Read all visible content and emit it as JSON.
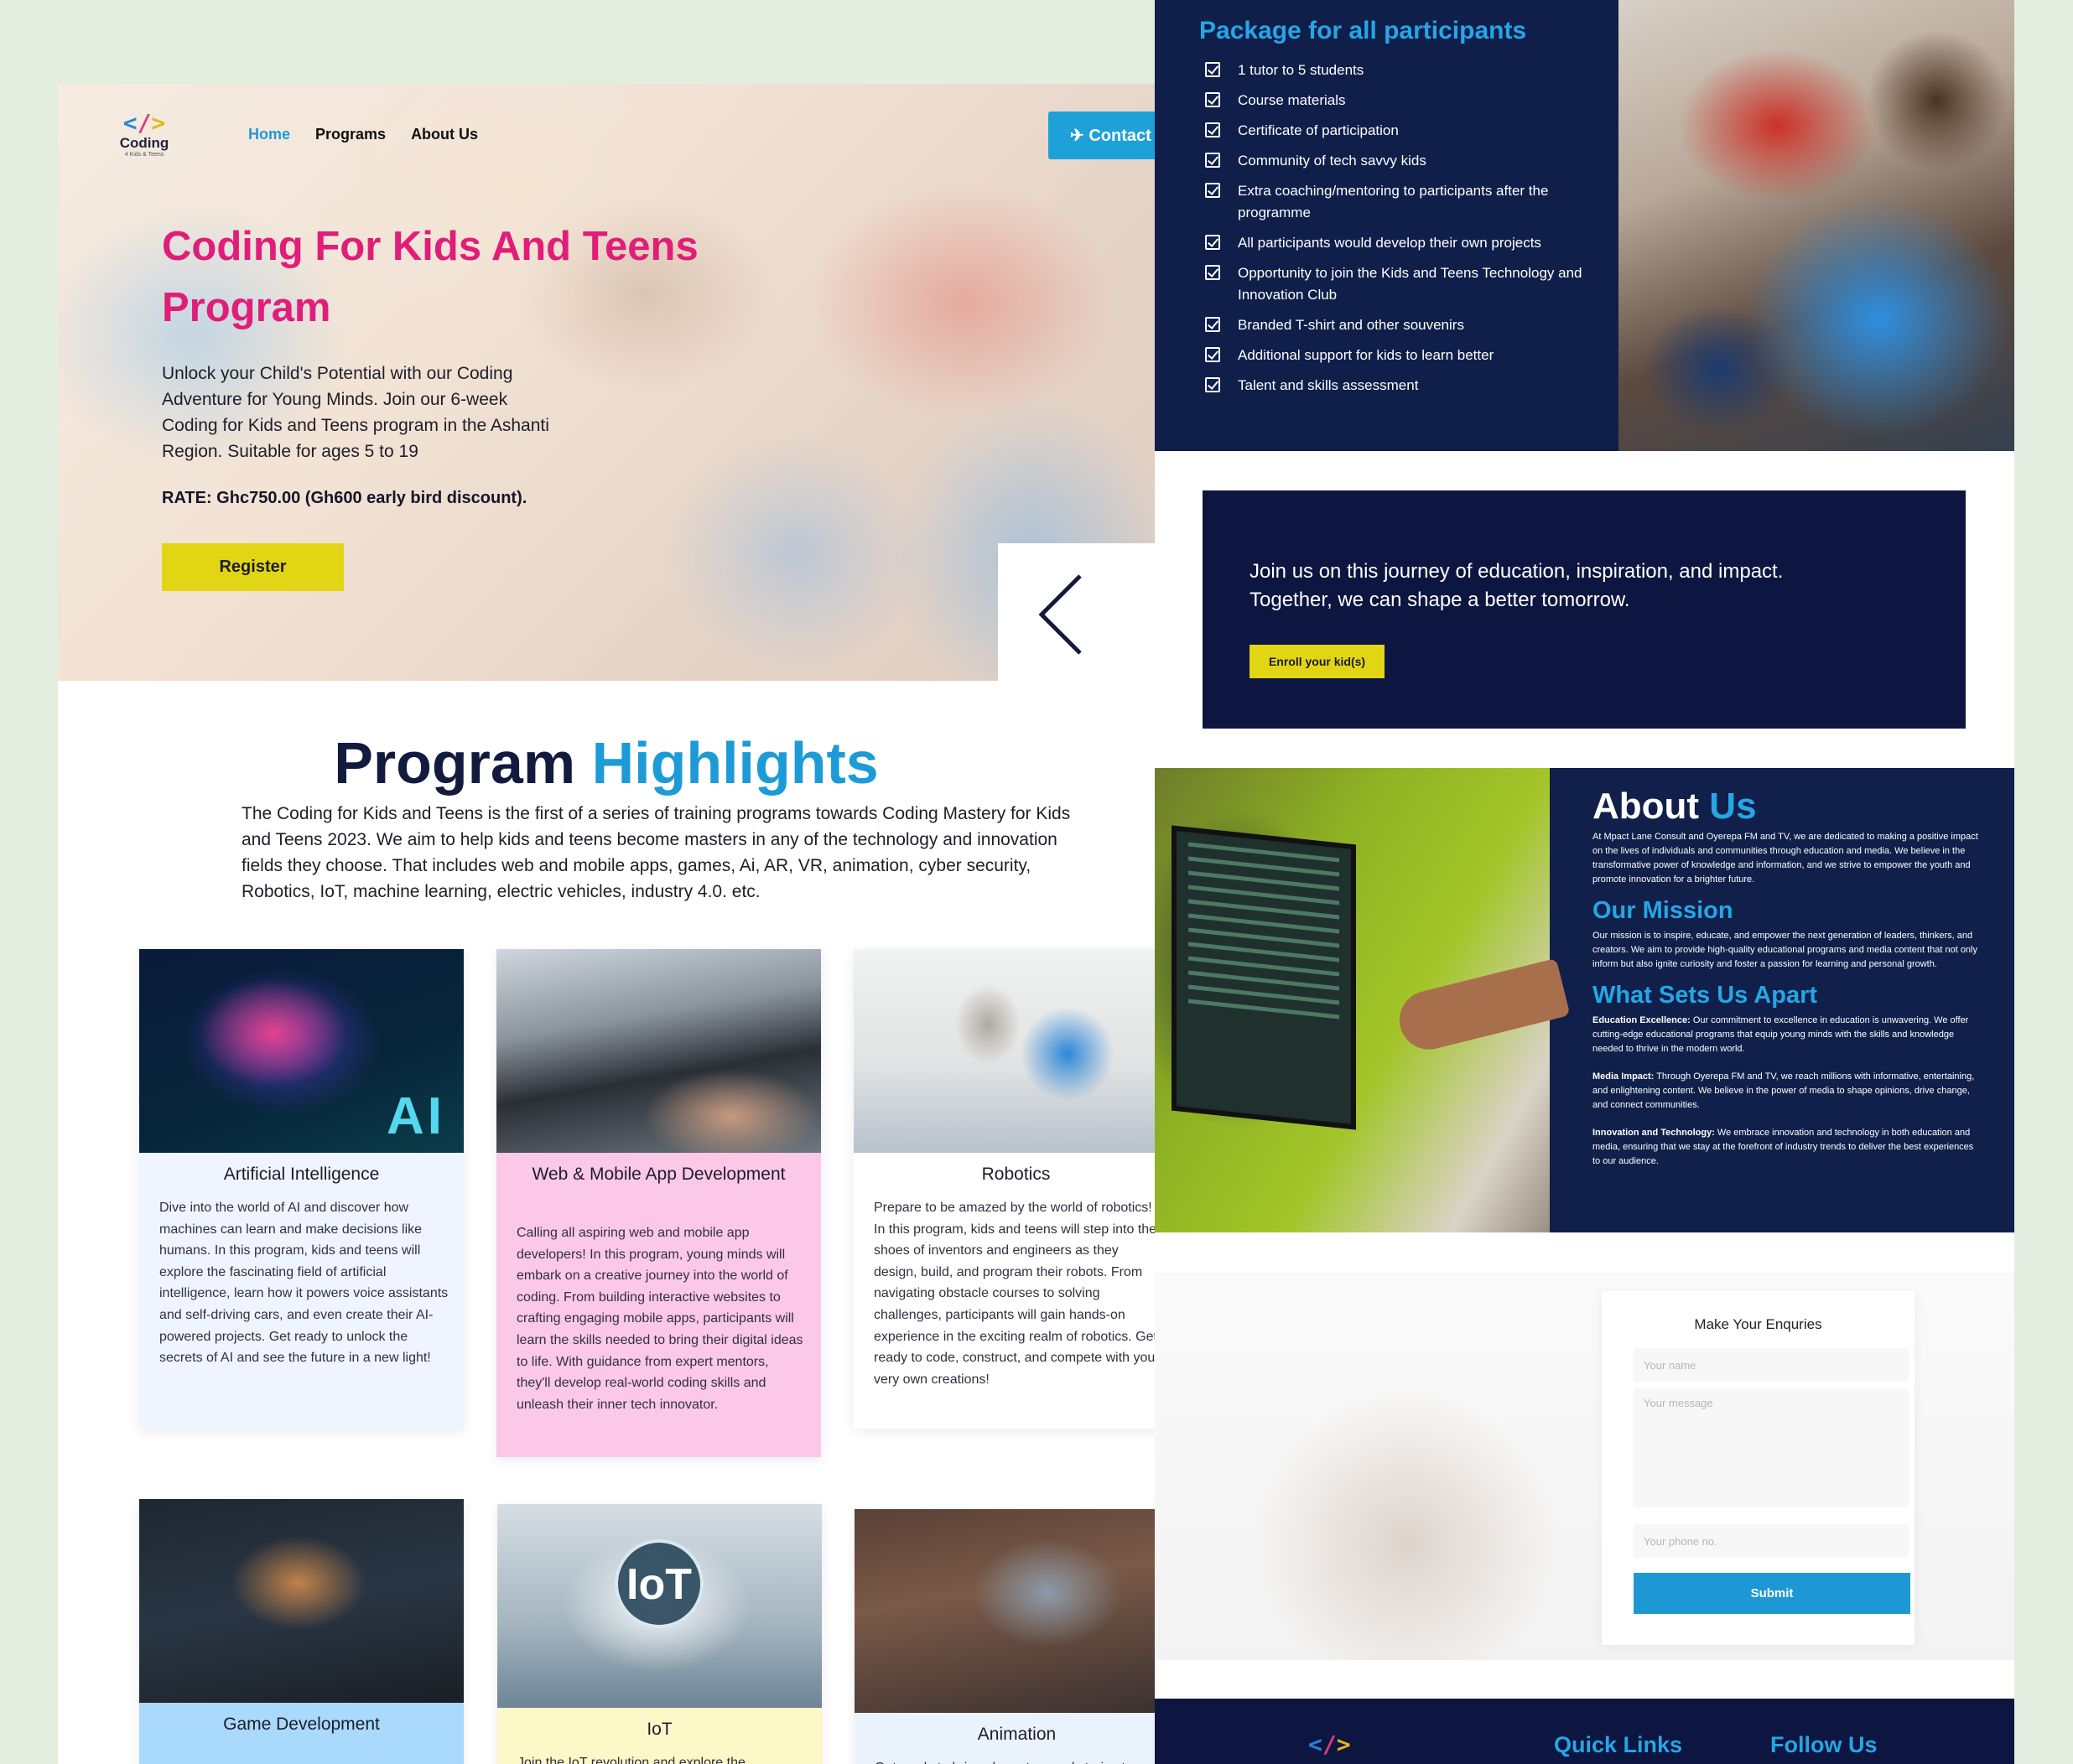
{
  "nav": {
    "logo_word": "Coding",
    "logo_sub": "4 Kids & Teens",
    "items": [
      "Home",
      "Programs",
      "About Us"
    ],
    "contact_label": "Contact"
  },
  "hero": {
    "title": "Coding For Kids And Teens Program",
    "description": "Unlock your Child's Potential with our Coding Adventure for Young Minds.  Join our 6-week Coding for Kids and Teens program in the Ashanti Region.  Suitable for ages 5 to 19",
    "rate": "RATE: Ghc750.00 (Gh600 early bird discount).",
    "register_label": "Register"
  },
  "highlights": {
    "title_main": "Program",
    "title_accent": "Highlights",
    "description": "The Coding for Kids and Teens is the first of a series of training programs towards Coding Mastery for Kids and Teens 2023. We aim to help kids and teens become masters in any of the technology and innovation fields they choose. That includes web and mobile apps, games, Ai, AR, VR, animation, cyber security, Robotics, IoT, machine learning, electric vehicles, industry 4.0. etc.",
    "cards": [
      {
        "title": "Artificial Intelligence",
        "image_text": "AI",
        "bg": "#eef5ff",
        "text": "Dive into the world of AI and discover how machines can learn and make decisions like humans. In this program, kids and teens will explore the fascinating field of artificial intelligence, learn how it powers voice assistants and self-driving cars, and even create their AI-powered projects. Get ready to unlock the secrets of AI and see the future in a new light!"
      },
      {
        "title": "Web & Mobile App Development",
        "bg": "#fcc8e8",
        "text": "Calling all aspiring web and mobile app developers! In this program, young minds will embark on a creative journey into the world of coding. From building interactive websites to crafting engaging mobile apps, participants will learn the skills needed to bring their digital ideas to life. With guidance from expert mentors, they'll develop real-world coding skills and unleash their inner tech innovator."
      },
      {
        "title": "Robotics",
        "bg": "#ffffff",
        "text": "Prepare to be amazed by the world of robotics! In this program, kids and teens will step into the shoes of inventors and engineers as they design, build, and program their robots. From navigating obstacle courses to solving challenges, participants will gain hands-on experience in the exciting realm of robotics. Get ready to code, construct, and compete with your very own creations!"
      },
      {
        "title": "Game Development",
        "bg": "#a9d9fb",
        "text": ""
      },
      {
        "title": "IoT",
        "image_text": "IoT",
        "bg": "#fdf8c8",
        "text": "Join the IoT revolution and explore the"
      },
      {
        "title": "Animation",
        "bg": "#eaf3fb",
        "text": "Get ready to bring characters and stories to"
      }
    ]
  },
  "package": {
    "title": "Package for all participants",
    "items": [
      "1 tutor to 5 students",
      "Course materials",
      "Certificate of participation",
      "Community of tech savvy kids",
      "Extra coaching/mentoring to participants after the programme",
      "All participants would develop their own projects",
      "Opportunity to join the Kids and Teens Technology and Innovation Club",
      "Branded T-shirt and other souvenirs",
      "Additional support for kids to learn better",
      "Talent and skills assessment"
    ]
  },
  "join": {
    "text": "Join us on this journey of education, inspiration, and impact. Together, we can shape a better tomorrow.",
    "enroll_label": "Enroll your kid(s)"
  },
  "about": {
    "title_main": "About",
    "title_accent": "Us",
    "intro": "At Mpact Lane Consult and Oyerepa FM and TV, we are dedicated to making a positive impact on the lives of individuals and communities through education and media. We believe in the transformative power of knowledge and information, and we strive to empower the youth and promote innovation for a brighter future.",
    "mission_title": "Our Mission",
    "mission_text": "Our mission is to inspire, educate, and empower the next generation of leaders, thinkers, and creators. We aim to provide high-quality educational programs and media content that not only inform but also ignite curiosity and foster a passion for learning and personal growth.",
    "apart_title": "What Sets Us Apart",
    "points": [
      {
        "label": "Education Excellence:",
        "text": " Our commitment to excellence in education is unwavering. We offer cutting-edge educational programs that equip young minds with the skills and knowledge needed to thrive in the modern world."
      },
      {
        "label": "Media Impact:",
        "text": " Through Oyerepa FM and TV, we reach millions with informative, entertaining, and enlightening content. We believe in the power of media to shape opinions, drive change, and connect communities."
      },
      {
        "label": "Innovation and Technology:",
        "text": " We embrace innovation and technology in both education and media, ensuring that we stay at the forefront of industry trends to deliver the best experiences to our audience."
      }
    ]
  },
  "enquiry": {
    "title": "Make Your Enquries",
    "name_placeholder": "Your name",
    "message_placeholder": "Your message",
    "phone_placeholder": "Your phone no.",
    "submit_label": "Submit"
  },
  "footer": {
    "quick_links": "Quick Links",
    "follow_us": "Follow Us"
  }
}
